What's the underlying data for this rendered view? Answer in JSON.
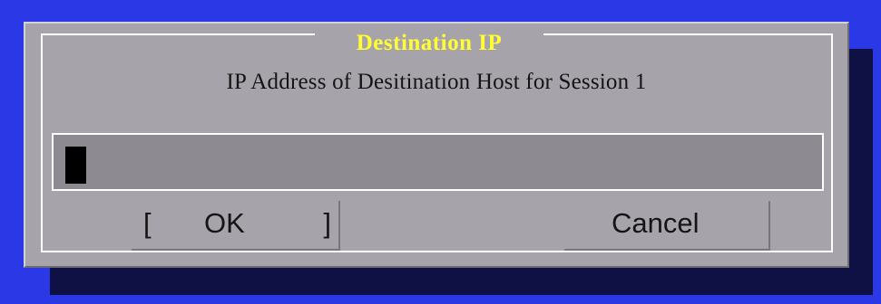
{
  "dialog": {
    "title": "Destination IP",
    "subtitle": "IP Address of Desitination Host for Session 1"
  },
  "input": {
    "value": ""
  },
  "buttons": {
    "ok": {
      "left_bracket": "[",
      "label": "OK",
      "right_bracket": "]"
    },
    "cancel": {
      "label": "Cancel"
    }
  },
  "colors": {
    "background": "#2b38e6",
    "shadow": "#0f1144",
    "dialog": "#a7a3aa",
    "title": "#ffff33",
    "field": "#8d8a92",
    "border": "#ffffff",
    "cursor": "#000000",
    "text": "#141414"
  }
}
